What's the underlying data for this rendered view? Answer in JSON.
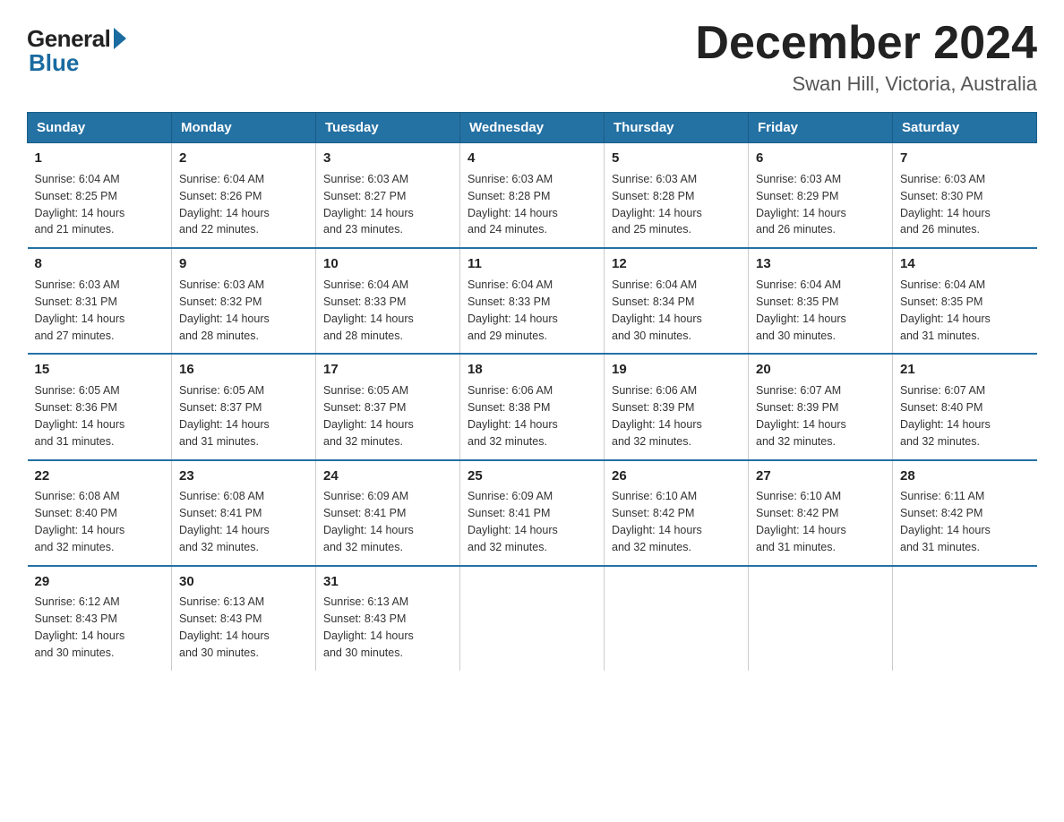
{
  "logo": {
    "general": "General",
    "blue": "Blue"
  },
  "title": {
    "month": "December 2024",
    "location": "Swan Hill, Victoria, Australia"
  },
  "headers": [
    "Sunday",
    "Monday",
    "Tuesday",
    "Wednesday",
    "Thursday",
    "Friday",
    "Saturday"
  ],
  "weeks": [
    [
      {
        "day": "1",
        "sunrise": "6:04 AM",
        "sunset": "8:25 PM",
        "daylight": "14 hours and 21 minutes."
      },
      {
        "day": "2",
        "sunrise": "6:04 AM",
        "sunset": "8:26 PM",
        "daylight": "14 hours and 22 minutes."
      },
      {
        "day": "3",
        "sunrise": "6:03 AM",
        "sunset": "8:27 PM",
        "daylight": "14 hours and 23 minutes."
      },
      {
        "day": "4",
        "sunrise": "6:03 AM",
        "sunset": "8:28 PM",
        "daylight": "14 hours and 24 minutes."
      },
      {
        "day": "5",
        "sunrise": "6:03 AM",
        "sunset": "8:28 PM",
        "daylight": "14 hours and 25 minutes."
      },
      {
        "day": "6",
        "sunrise": "6:03 AM",
        "sunset": "8:29 PM",
        "daylight": "14 hours and 26 minutes."
      },
      {
        "day": "7",
        "sunrise": "6:03 AM",
        "sunset": "8:30 PM",
        "daylight": "14 hours and 26 minutes."
      }
    ],
    [
      {
        "day": "8",
        "sunrise": "6:03 AM",
        "sunset": "8:31 PM",
        "daylight": "14 hours and 27 minutes."
      },
      {
        "day": "9",
        "sunrise": "6:03 AM",
        "sunset": "8:32 PM",
        "daylight": "14 hours and 28 minutes."
      },
      {
        "day": "10",
        "sunrise": "6:04 AM",
        "sunset": "8:33 PM",
        "daylight": "14 hours and 28 minutes."
      },
      {
        "day": "11",
        "sunrise": "6:04 AM",
        "sunset": "8:33 PM",
        "daylight": "14 hours and 29 minutes."
      },
      {
        "day": "12",
        "sunrise": "6:04 AM",
        "sunset": "8:34 PM",
        "daylight": "14 hours and 30 minutes."
      },
      {
        "day": "13",
        "sunrise": "6:04 AM",
        "sunset": "8:35 PM",
        "daylight": "14 hours and 30 minutes."
      },
      {
        "day": "14",
        "sunrise": "6:04 AM",
        "sunset": "8:35 PM",
        "daylight": "14 hours and 31 minutes."
      }
    ],
    [
      {
        "day": "15",
        "sunrise": "6:05 AM",
        "sunset": "8:36 PM",
        "daylight": "14 hours and 31 minutes."
      },
      {
        "day": "16",
        "sunrise": "6:05 AM",
        "sunset": "8:37 PM",
        "daylight": "14 hours and 31 minutes."
      },
      {
        "day": "17",
        "sunrise": "6:05 AM",
        "sunset": "8:37 PM",
        "daylight": "14 hours and 32 minutes."
      },
      {
        "day": "18",
        "sunrise": "6:06 AM",
        "sunset": "8:38 PM",
        "daylight": "14 hours and 32 minutes."
      },
      {
        "day": "19",
        "sunrise": "6:06 AM",
        "sunset": "8:39 PM",
        "daylight": "14 hours and 32 minutes."
      },
      {
        "day": "20",
        "sunrise": "6:07 AM",
        "sunset": "8:39 PM",
        "daylight": "14 hours and 32 minutes."
      },
      {
        "day": "21",
        "sunrise": "6:07 AM",
        "sunset": "8:40 PM",
        "daylight": "14 hours and 32 minutes."
      }
    ],
    [
      {
        "day": "22",
        "sunrise": "6:08 AM",
        "sunset": "8:40 PM",
        "daylight": "14 hours and 32 minutes."
      },
      {
        "day": "23",
        "sunrise": "6:08 AM",
        "sunset": "8:41 PM",
        "daylight": "14 hours and 32 minutes."
      },
      {
        "day": "24",
        "sunrise": "6:09 AM",
        "sunset": "8:41 PM",
        "daylight": "14 hours and 32 minutes."
      },
      {
        "day": "25",
        "sunrise": "6:09 AM",
        "sunset": "8:41 PM",
        "daylight": "14 hours and 32 minutes."
      },
      {
        "day": "26",
        "sunrise": "6:10 AM",
        "sunset": "8:42 PM",
        "daylight": "14 hours and 32 minutes."
      },
      {
        "day": "27",
        "sunrise": "6:10 AM",
        "sunset": "8:42 PM",
        "daylight": "14 hours and 31 minutes."
      },
      {
        "day": "28",
        "sunrise": "6:11 AM",
        "sunset": "8:42 PM",
        "daylight": "14 hours and 31 minutes."
      }
    ],
    [
      {
        "day": "29",
        "sunrise": "6:12 AM",
        "sunset": "8:43 PM",
        "daylight": "14 hours and 30 minutes."
      },
      {
        "day": "30",
        "sunrise": "6:13 AM",
        "sunset": "8:43 PM",
        "daylight": "14 hours and 30 minutes."
      },
      {
        "day": "31",
        "sunrise": "6:13 AM",
        "sunset": "8:43 PM",
        "daylight": "14 hours and 30 minutes."
      },
      null,
      null,
      null,
      null
    ]
  ],
  "labels": {
    "sunrise": "Sunrise:",
    "sunset": "Sunset:",
    "daylight": "Daylight:"
  }
}
